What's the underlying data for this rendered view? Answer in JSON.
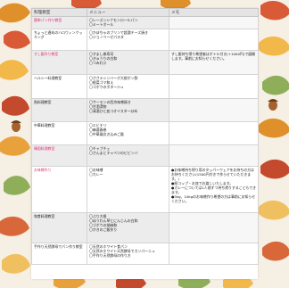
{
  "table": {
    "headers": [
      "料理教室",
      "メニュー",
      "メモ"
    ],
    "rows": [
      {
        "name": "簡単パン作り教室",
        "name_pink": true,
        "menu": [
          "〇レーズンシナモンロールパン",
          "〇ミートボール"
        ],
        "memo": []
      },
      {
        "name": "ちょっと遅めのハロウィンクッキング",
        "name_pink": false,
        "menu": [
          "〇かぼちゃのプリンで超濃チーズ焼き",
          "〇ジョノベーゼパスタ"
        ],
        "memo": []
      },
      {
        "name": "すし飯作り教室",
        "name_pink": true,
        "menu": [
          "〇すまし巻寿司",
          "〇きゅうりの白和",
          "〇つみれ汁"
        ],
        "memo": [
          "すし飯持ち帰り希望者はボトル付き(+1000円)で展開します。事前にお知らせください。"
        ]
      },
      {
        "name": "ヘルシー料理教室",
        "name_pink": false,
        "menu": [
          "〇ささミシンバーグ大根ポン酢",
          "〇根菜ゴマ和え",
          "〇ゴボウのポタージュ"
        ],
        "memo": []
      },
      {
        "name": "魚料理教室",
        "name_pink": false,
        "menu": [
          "〇サーモンの西京味噌焼き",
          "〇甘酒漬物",
          "〇清湯ひと皿コオイスター炒め"
        ],
        "memo": []
      },
      {
        "name": "中華料理教室",
        "name_pink": false,
        "menu": [
          "〇エビチリ",
          "〇麻婆春巻",
          "〇中華風炊き込みご飯"
        ],
        "memo": []
      },
      {
        "name": "韓国料理教室",
        "name_pink": true,
        "menu": [
          "〇チャプチェ",
          "〇さんまとキャベツのビビンバ"
        ],
        "memo": []
      },
      {
        "name": "お味噌作り",
        "name_pink": true,
        "menu": [
          "〇お味噌",
          "〇カレー"
        ],
        "memo": [
          "●お味噌持ち帰り用のタッパーウェアをお持ちの方はお持ちください(1500円付きで作らせていただきます。)",
          "●紙コップ・お皿でお渡しいたします。",
          "●カレーについては1人前ずつ持ち帰りすることもできます。",
          "●5kg、10kgのお味噌作り希望の方は事前にお知らせください。"
        ]
      },
      {
        "name": "和食料理教室",
        "name_pink": false,
        "menu": [
          "〇ぶり大根",
          "〇ほうれん草とにんじんの白和",
          "〇ゴボウの胡麻和",
          "〇かきのご飯作り"
        ],
        "memo": []
      },
      {
        "name": "手作り天然酵母でパン作り教室",
        "name_pink": false,
        "menu": [
          "〇天然のホワイト食パン",
          "〇天然のホワイト天然酵母でカンパーニュ",
          "〇手作り天然酵母の作り方"
        ],
        "memo": []
      }
    ]
  },
  "colors": {
    "accent_pink": "#e0307a",
    "header_bg": "#e4e4e4",
    "row_alt": "#ececec",
    "page_bg": "#f6efe4"
  },
  "decor_icons": [
    "autumn-leaf-icon",
    "acorn-icon"
  ]
}
